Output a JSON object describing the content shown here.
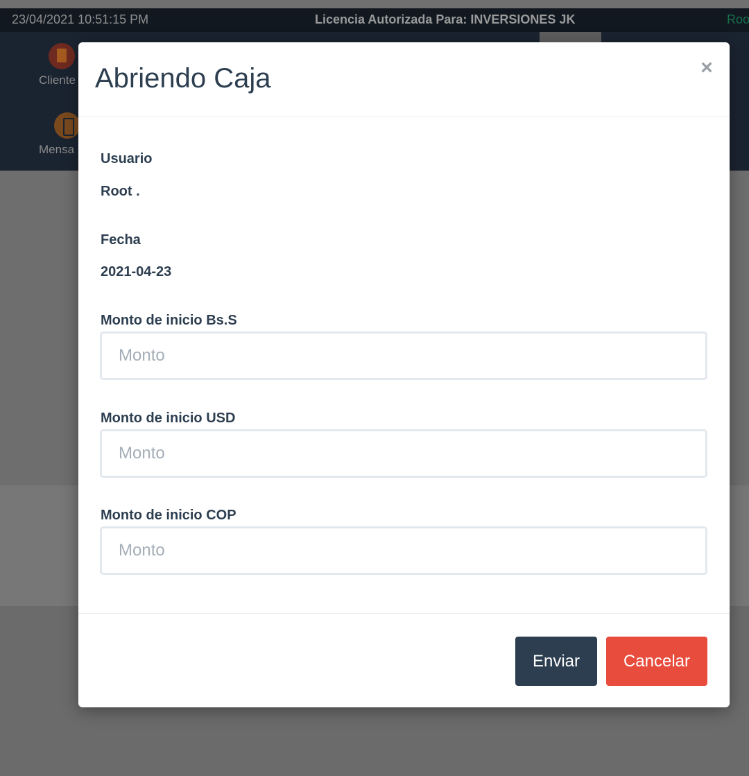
{
  "statusbar": {
    "datetime": "23/04/2021 10:51:15 PM",
    "license": "Licencia Autorizada Para: INVERSIONES JK",
    "user_fragment": "Roo"
  },
  "launchers": [
    {
      "label": "Cliente",
      "icon": "address-book-icon"
    },
    {
      "label": "Mensa",
      "icon": "mobile-phone-icon"
    }
  ],
  "modal": {
    "title": "Abriendo Caja",
    "close_symbol": "×",
    "user_label": "Usuario",
    "user_value": "Root .",
    "date_label": "Fecha",
    "date_value": "2021-04-23",
    "fields": [
      {
        "label": "Monto de inicio Bs.S",
        "placeholder": "Monto",
        "value": ""
      },
      {
        "label": "Monto de inicio USD",
        "placeholder": "Monto",
        "value": ""
      },
      {
        "label": "Monto de inicio COP",
        "placeholder": "Monto",
        "value": ""
      }
    ],
    "submit_label": "Enviar",
    "cancel_label": "Cancelar"
  },
  "colors": {
    "primary": "#2c3e50",
    "danger": "#e74c3c",
    "overlay": "#6b6b6b"
  }
}
